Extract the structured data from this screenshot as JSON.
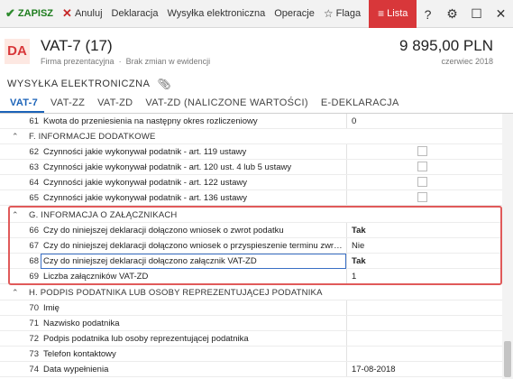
{
  "toolbar": {
    "save": "ZAPISZ",
    "cancel": "Anuluj",
    "declaration": "Deklaracja",
    "send": "Wysyłka elektroniczna",
    "operations": "Operacje",
    "flag": "Flaga",
    "list": "Lista",
    "right_icons": [
      "?",
      "⚙",
      "☐",
      "✕"
    ]
  },
  "header": {
    "badge": "DA",
    "title": "VAT-7 (17)",
    "company": "Firma prezentacyjna",
    "separator": "·",
    "status": "Brak zmian w ewidencji",
    "amount": "9 895,00 PLN",
    "period": "czerwiec 2018"
  },
  "section": {
    "title": "WYSYŁKA ELEKTRONICZNA"
  },
  "tabs": [
    "VAT-7",
    "VAT-ZZ",
    "VAT-ZD",
    "VAT-ZD (NALICZONE WARTOŚCI)",
    "E-DEKLARACJA"
  ],
  "rows": {
    "r61": {
      "num": "61",
      "label": "Kwota do przeniesienia na następny okres rozliczeniowy",
      "value": "0"
    },
    "gF": {
      "label": "F. INFORMACJE DODATKOWE"
    },
    "r62": {
      "num": "62",
      "label": "Czynności jakie wykonywał podatnik - art. 119 ustawy"
    },
    "r63": {
      "num": "63",
      "label": "Czynności jakie wykonywał podatnik - art. 120 ust. 4 lub 5 ustawy"
    },
    "r64": {
      "num": "64",
      "label": "Czynności jakie wykonywał podatnik - art. 122 ustawy"
    },
    "r65": {
      "num": "65",
      "label": "Czynności jakie wykonywał podatnik - art. 136 ustawy"
    },
    "gG": {
      "label": "G. INFORMACJA O ZAŁĄCZNIKACH"
    },
    "r66": {
      "num": "66",
      "label": "Czy do niniejszej deklaracji dołączono wniosek o zwrot podatku",
      "value": "Tak"
    },
    "r67": {
      "num": "67",
      "label": "Czy do niniejszej deklaracji dołączono wniosek o przyspieszenie terminu zwrotu p...",
      "value": "Nie"
    },
    "r68": {
      "num": "68",
      "label": "Czy do niniejszej deklaracji dołączono załącznik VAT-ZD",
      "value": "Tak"
    },
    "r69": {
      "num": "69",
      "label": "Liczba załączników VAT-ZD",
      "value": "1"
    },
    "gH": {
      "label": "H. PODPIS PODATNIKA LUB OSOBY REPREZENTUJĄCEJ PODATNIKA"
    },
    "r70": {
      "num": "70",
      "label": "Imię"
    },
    "r71": {
      "num": "71",
      "label": "Nazwisko podatnika"
    },
    "r72": {
      "num": "72",
      "label": "Podpis podatnika lub osoby reprezentującej podatnika"
    },
    "r73": {
      "num": "73",
      "label": "Telefon kontaktowy"
    },
    "r74": {
      "num": "74",
      "label": "Data wypełnienia",
      "value": "17-08-2018"
    }
  },
  "colors": {
    "accent": "#d8373a",
    "tab_active": "#1c63b8",
    "highlight": "#e05a5a"
  }
}
